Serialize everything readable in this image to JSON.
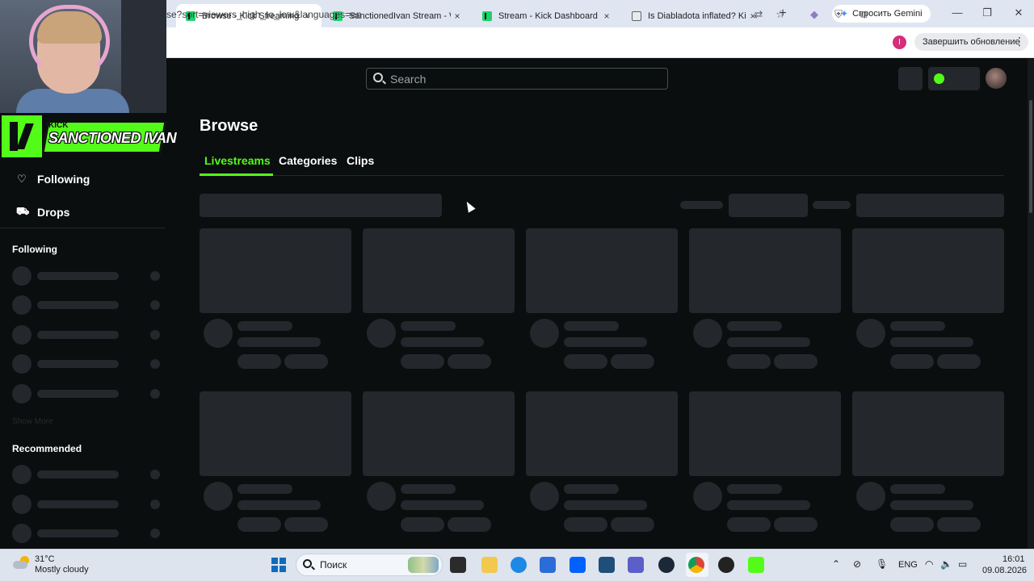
{
  "browser": {
    "tabs": [
      {
        "title": "Browse - Kick Streaming",
        "active": true,
        "icon": "kick-favicon"
      },
      {
        "title": "SanctionedIvan Stream - Wa",
        "active": false,
        "icon": "kick-favicon"
      },
      {
        "title": "Stream - Kick Dashboard",
        "active": false,
        "icon": "kick-favicon"
      },
      {
        "title": "Is Diabladota inflated? Kick",
        "active": false,
        "icon": "doc-favicon"
      }
    ],
    "close_glyph": "×",
    "new_tab_glyph": "+",
    "gemini_label": "Спросить Gemini",
    "window_controls": {
      "minimize": "—",
      "maximize": "❐",
      "close": "✕"
    },
    "url": "se?sort=viewers_high_to_low&languages=en",
    "update_button": "Завершить обновление",
    "profile_initial": "I",
    "icons": [
      "translate-icon",
      "bookmark-star-icon",
      "extension-icon",
      "shield-icon",
      "puzzle-icon"
    ]
  },
  "overlay": {
    "brand_small": "KICK",
    "channel_name": "SANCTIONED IVAN"
  },
  "kick": {
    "search_placeholder": "Search",
    "page_title": "Browse",
    "tabs": [
      "Livestreams",
      "Categories",
      "Clips"
    ],
    "active_tab": "Livestreams",
    "sidebar": {
      "links": [
        {
          "label": "Following",
          "icon": "heart-icon"
        },
        {
          "label": "Drops",
          "icon": "drops-icon"
        }
      ],
      "following_heading": "Following",
      "show_more": "Show More",
      "recommended_heading": "Recommended"
    },
    "accent_color": "#53fc18",
    "skeleton_color": "#24272c",
    "background_color": "#0b0e0f"
  },
  "taskbar": {
    "temperature": "31°C",
    "condition": "Mostly cloudy",
    "search_label": "Поиск",
    "language": "ENG",
    "time": "16:01",
    "date": "09.08.2026"
  }
}
